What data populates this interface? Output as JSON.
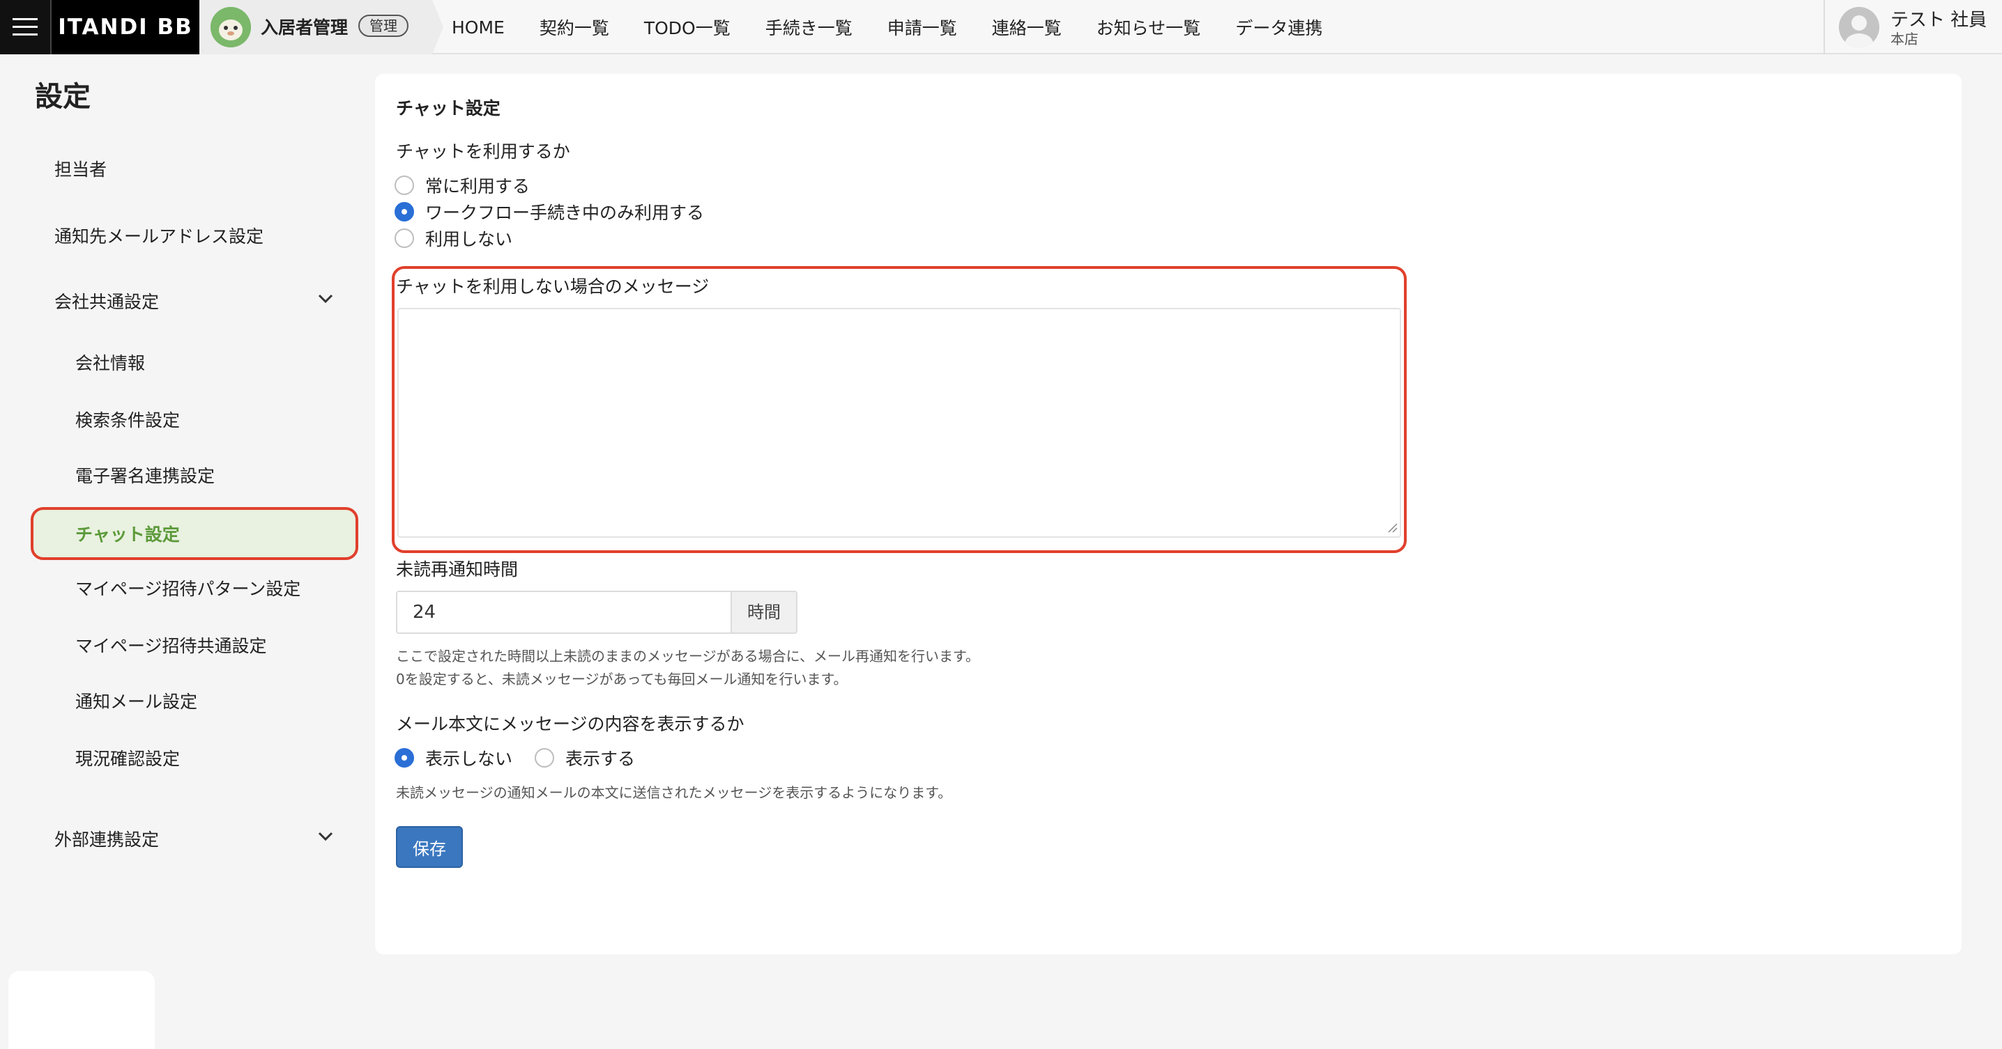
{
  "header": {
    "brand": "ITANDI BB",
    "app_name": "入居者管理",
    "admin_badge": "管理",
    "nav": [
      "HOME",
      "契約一覧",
      "TODO一覧",
      "手続き一覧",
      "申請一覧",
      "連絡一覧",
      "お知らせ一覧",
      "データ連携"
    ],
    "user_name": "テスト 社員",
    "user_branch": "本店"
  },
  "sidebar": {
    "title": "設定",
    "items": [
      {
        "label": "担当者"
      },
      {
        "label": "通知先メールアドレス設定"
      },
      {
        "label": "会社共通設定"
      },
      {
        "label": "会社情報"
      },
      {
        "label": "検索条件設定"
      },
      {
        "label": "電子署名連携設定"
      },
      {
        "label": "チャット設定"
      },
      {
        "label": "マイページ招待パターン設定"
      },
      {
        "label": "マイページ招待共通設定"
      },
      {
        "label": "通知メール設定"
      },
      {
        "label": "現況確認設定"
      },
      {
        "label": "外部連携設定"
      }
    ],
    "active_item": "チャット設定"
  },
  "main": {
    "section_title": "チャット設定",
    "use_chat_label": "チャットを利用するか",
    "use_chat_options": [
      "常に利用する",
      "ワークフロー手続き中のみ利用する",
      "利用しない"
    ],
    "use_chat_selected": "ワークフロー手続き中のみ利用する",
    "message_label": "チャットを利用しない場合のメッセージ",
    "message_value": "",
    "renotify_label": "未読再通知時間",
    "renotify_value": "24",
    "renotify_unit": "時間",
    "renotify_help_1": "ここで設定された時間以上未読のままのメッセージがある場合に、メール再通知を行います。",
    "renotify_help_2": "0を設定すると、未読メッセージがあっても毎回メール通知を行います。",
    "mail_body_label": "メール本文にメッセージの内容を表示するか",
    "mail_body_options": [
      "表示しない",
      "表示する"
    ],
    "mail_body_selected": "表示しない",
    "mail_body_help": "未読メッセージの通知メールの本文に送信されたメッセージを表示するようになります。",
    "save_label": "保存"
  },
  "colors": {
    "accent": "#2a6fd6",
    "highlight": "#e0402c",
    "active_bg": "#e9f1e0",
    "active_text": "#5c9a3a",
    "save_button": "#3b77bf"
  }
}
